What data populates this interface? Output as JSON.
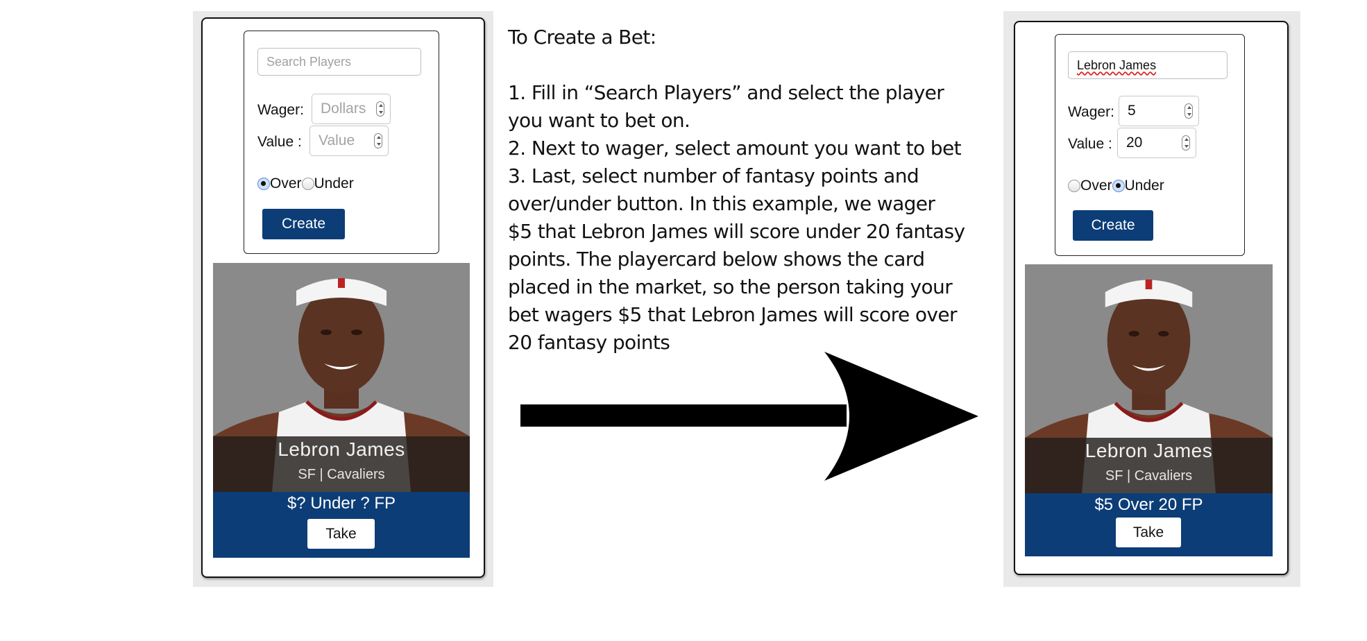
{
  "instructions": {
    "heading": "To Create a Bet:",
    "lines": [
      "1. Fill in “Search Players” and select the player",
      "you want to bet on.",
      "2. Next to wager, select amount you want to bet",
      "3. Last, select number of fantasy points and",
      "over/under button.  In this example, we wager",
      "$5 that Lebron James will score under 20 fantasy",
      "points. The playercard below shows the card",
      "placed in the market, so the person taking your",
      "bet wagers $5 that Lebron James will score over",
      "20 fantasy points"
    ]
  },
  "before": {
    "search": {
      "value": "",
      "placeholder": "Search Players"
    },
    "wager": {
      "label": "Wager:",
      "value": "",
      "placeholder": "Dollars"
    },
    "value": {
      "label": "Value :",
      "value": "",
      "placeholder": "Value"
    },
    "radio": {
      "over_label": "Over",
      "under_label": "Under",
      "selected": "over"
    },
    "create_label": "Create",
    "card": {
      "player_name": "Lebron James",
      "team_line": "SF | Cavaliers",
      "bet_line": "$? Under ? FP",
      "take_label": "Take"
    }
  },
  "after": {
    "search": {
      "value": "Lebron James",
      "placeholder": "Search Players"
    },
    "wager": {
      "label": "Wager:",
      "value": "5",
      "placeholder": "Dollars"
    },
    "value": {
      "label": "Value :",
      "value": "20",
      "placeholder": "Value"
    },
    "radio": {
      "over_label": "Over",
      "under_label": "Under",
      "selected": "under"
    },
    "create_label": "Create",
    "card": {
      "player_name": "Lebron James",
      "team_line": "SF | Cavaliers",
      "bet_line": "$5 Over 20 FP",
      "take_label": "Take"
    }
  },
  "icons": {
    "arrow": "right-arrow-icon"
  },
  "colors": {
    "brand_navy": "#0c3d77",
    "panel_gray": "#e9e9e9"
  }
}
